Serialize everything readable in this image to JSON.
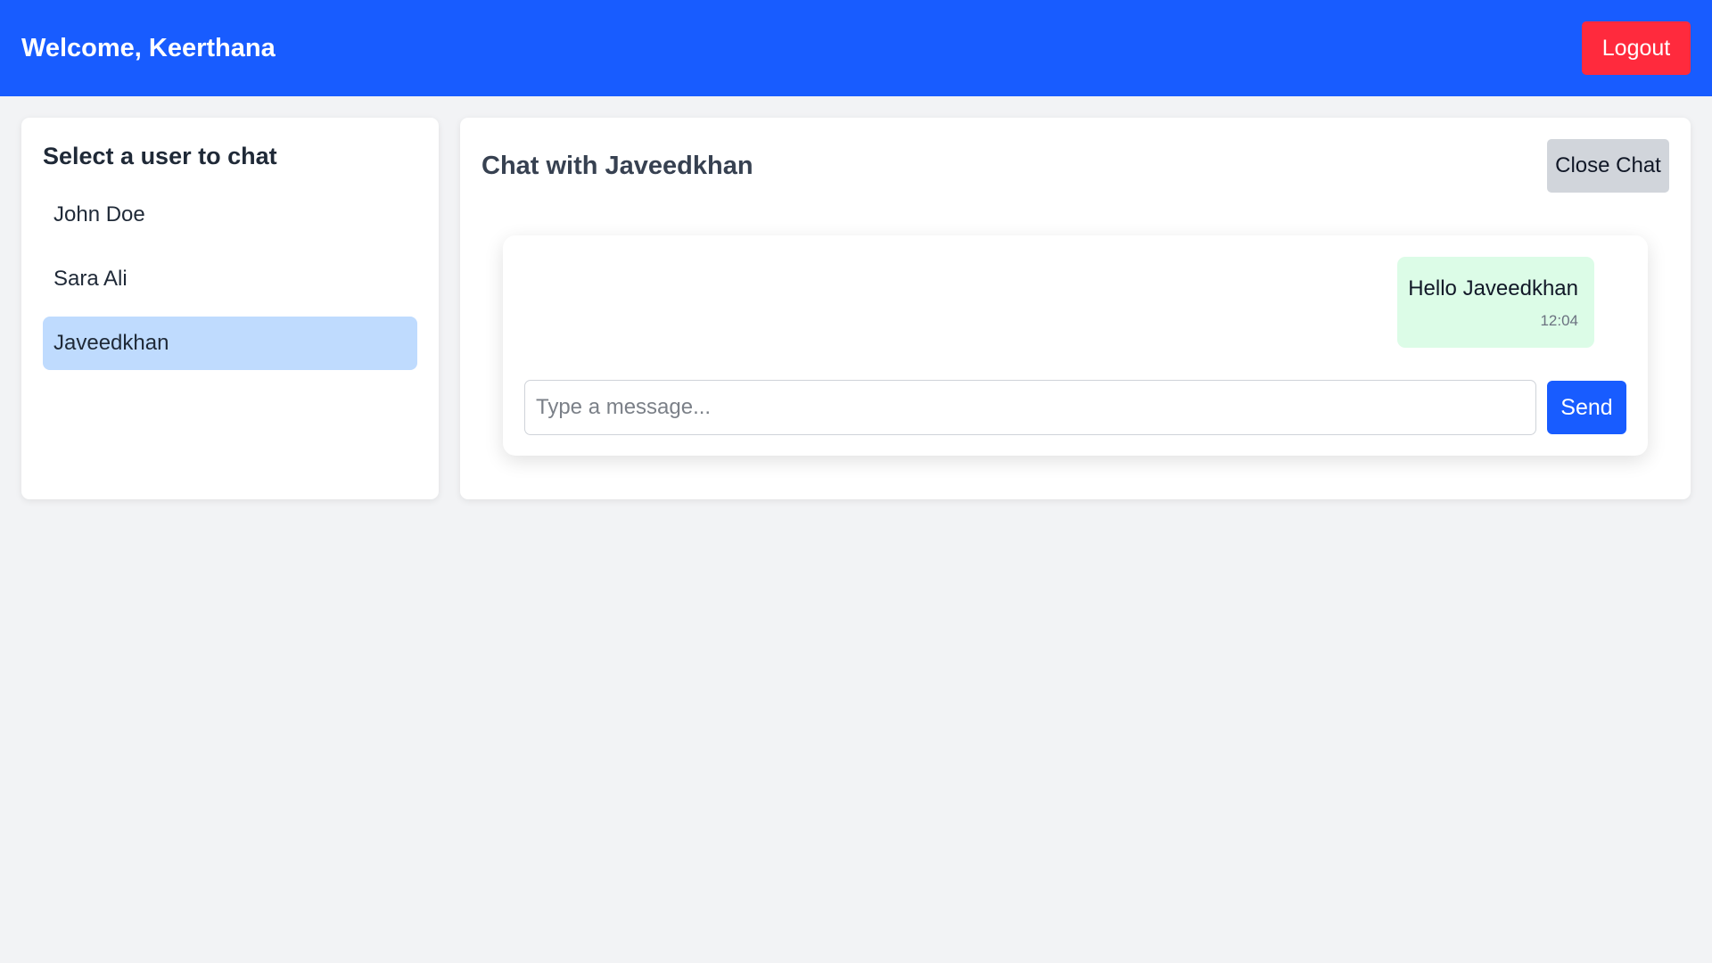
{
  "header": {
    "welcome_text": "Welcome, Keerthana",
    "logout_label": "Logout"
  },
  "sidebar": {
    "title": "Select a user to chat",
    "users": [
      {
        "name": "John Doe",
        "active": false
      },
      {
        "name": "Sara Ali",
        "active": false
      },
      {
        "name": "Javeedkhan",
        "active": true
      }
    ]
  },
  "chat": {
    "title": "Chat with Javeedkhan",
    "close_label": "Close Chat",
    "messages": [
      {
        "text": "Hello Javeedkhan",
        "time": "12:04",
        "outgoing": true
      }
    ],
    "input": {
      "value": "",
      "placeholder": "Type a message..."
    },
    "send_label": "Send"
  },
  "colors": {
    "header_bg": "#185cff",
    "logout_bg": "#ff2a3d",
    "active_user_bg": "#bfdbfe",
    "outgoing_bubble_bg": "#dcfce7",
    "send_bg": "#185cff",
    "close_bg": "#d1d5db",
    "page_bg": "#f2f3f5"
  }
}
